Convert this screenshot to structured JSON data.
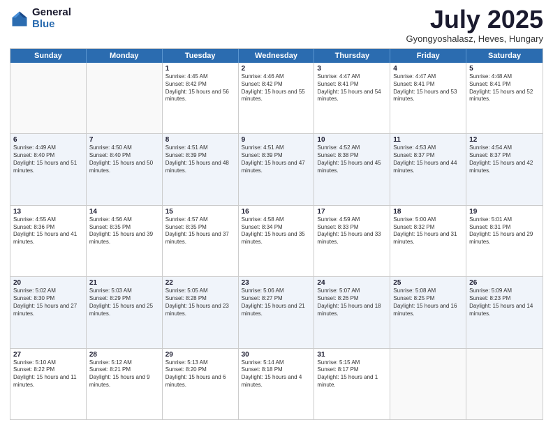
{
  "header": {
    "logo_general": "General",
    "logo_blue": "Blue",
    "title": "July 2025",
    "location": "Gyongyoshalasz, Heves, Hungary"
  },
  "days_of_week": [
    "Sunday",
    "Monday",
    "Tuesday",
    "Wednesday",
    "Thursday",
    "Friday",
    "Saturday"
  ],
  "weeks": [
    {
      "alt": false,
      "cells": [
        {
          "day": "",
          "empty": true
        },
        {
          "day": "",
          "empty": true
        },
        {
          "day": "1",
          "sunrise": "Sunrise: 4:45 AM",
          "sunset": "Sunset: 8:42 PM",
          "daylight": "Daylight: 15 hours and 56 minutes."
        },
        {
          "day": "2",
          "sunrise": "Sunrise: 4:46 AM",
          "sunset": "Sunset: 8:42 PM",
          "daylight": "Daylight: 15 hours and 55 minutes."
        },
        {
          "day": "3",
          "sunrise": "Sunrise: 4:47 AM",
          "sunset": "Sunset: 8:41 PM",
          "daylight": "Daylight: 15 hours and 54 minutes."
        },
        {
          "day": "4",
          "sunrise": "Sunrise: 4:47 AM",
          "sunset": "Sunset: 8:41 PM",
          "daylight": "Daylight: 15 hours and 53 minutes."
        },
        {
          "day": "5",
          "sunrise": "Sunrise: 4:48 AM",
          "sunset": "Sunset: 8:41 PM",
          "daylight": "Daylight: 15 hours and 52 minutes."
        }
      ]
    },
    {
      "alt": true,
      "cells": [
        {
          "day": "6",
          "sunrise": "Sunrise: 4:49 AM",
          "sunset": "Sunset: 8:40 PM",
          "daylight": "Daylight: 15 hours and 51 minutes."
        },
        {
          "day": "7",
          "sunrise": "Sunrise: 4:50 AM",
          "sunset": "Sunset: 8:40 PM",
          "daylight": "Daylight: 15 hours and 50 minutes."
        },
        {
          "day": "8",
          "sunrise": "Sunrise: 4:51 AM",
          "sunset": "Sunset: 8:39 PM",
          "daylight": "Daylight: 15 hours and 48 minutes."
        },
        {
          "day": "9",
          "sunrise": "Sunrise: 4:51 AM",
          "sunset": "Sunset: 8:39 PM",
          "daylight": "Daylight: 15 hours and 47 minutes."
        },
        {
          "day": "10",
          "sunrise": "Sunrise: 4:52 AM",
          "sunset": "Sunset: 8:38 PM",
          "daylight": "Daylight: 15 hours and 45 minutes."
        },
        {
          "day": "11",
          "sunrise": "Sunrise: 4:53 AM",
          "sunset": "Sunset: 8:37 PM",
          "daylight": "Daylight: 15 hours and 44 minutes."
        },
        {
          "day": "12",
          "sunrise": "Sunrise: 4:54 AM",
          "sunset": "Sunset: 8:37 PM",
          "daylight": "Daylight: 15 hours and 42 minutes."
        }
      ]
    },
    {
      "alt": false,
      "cells": [
        {
          "day": "13",
          "sunrise": "Sunrise: 4:55 AM",
          "sunset": "Sunset: 8:36 PM",
          "daylight": "Daylight: 15 hours and 41 minutes."
        },
        {
          "day": "14",
          "sunrise": "Sunrise: 4:56 AM",
          "sunset": "Sunset: 8:35 PM",
          "daylight": "Daylight: 15 hours and 39 minutes."
        },
        {
          "day": "15",
          "sunrise": "Sunrise: 4:57 AM",
          "sunset": "Sunset: 8:35 PM",
          "daylight": "Daylight: 15 hours and 37 minutes."
        },
        {
          "day": "16",
          "sunrise": "Sunrise: 4:58 AM",
          "sunset": "Sunset: 8:34 PM",
          "daylight": "Daylight: 15 hours and 35 minutes."
        },
        {
          "day": "17",
          "sunrise": "Sunrise: 4:59 AM",
          "sunset": "Sunset: 8:33 PM",
          "daylight": "Daylight: 15 hours and 33 minutes."
        },
        {
          "day": "18",
          "sunrise": "Sunrise: 5:00 AM",
          "sunset": "Sunset: 8:32 PM",
          "daylight": "Daylight: 15 hours and 31 minutes."
        },
        {
          "day": "19",
          "sunrise": "Sunrise: 5:01 AM",
          "sunset": "Sunset: 8:31 PM",
          "daylight": "Daylight: 15 hours and 29 minutes."
        }
      ]
    },
    {
      "alt": true,
      "cells": [
        {
          "day": "20",
          "sunrise": "Sunrise: 5:02 AM",
          "sunset": "Sunset: 8:30 PM",
          "daylight": "Daylight: 15 hours and 27 minutes."
        },
        {
          "day": "21",
          "sunrise": "Sunrise: 5:03 AM",
          "sunset": "Sunset: 8:29 PM",
          "daylight": "Daylight: 15 hours and 25 minutes."
        },
        {
          "day": "22",
          "sunrise": "Sunrise: 5:05 AM",
          "sunset": "Sunset: 8:28 PM",
          "daylight": "Daylight: 15 hours and 23 minutes."
        },
        {
          "day": "23",
          "sunrise": "Sunrise: 5:06 AM",
          "sunset": "Sunset: 8:27 PM",
          "daylight": "Daylight: 15 hours and 21 minutes."
        },
        {
          "day": "24",
          "sunrise": "Sunrise: 5:07 AM",
          "sunset": "Sunset: 8:26 PM",
          "daylight": "Daylight: 15 hours and 18 minutes."
        },
        {
          "day": "25",
          "sunrise": "Sunrise: 5:08 AM",
          "sunset": "Sunset: 8:25 PM",
          "daylight": "Daylight: 15 hours and 16 minutes."
        },
        {
          "day": "26",
          "sunrise": "Sunrise: 5:09 AM",
          "sunset": "Sunset: 8:23 PM",
          "daylight": "Daylight: 15 hours and 14 minutes."
        }
      ]
    },
    {
      "alt": false,
      "cells": [
        {
          "day": "27",
          "sunrise": "Sunrise: 5:10 AM",
          "sunset": "Sunset: 8:22 PM",
          "daylight": "Daylight: 15 hours and 11 minutes."
        },
        {
          "day": "28",
          "sunrise": "Sunrise: 5:12 AM",
          "sunset": "Sunset: 8:21 PM",
          "daylight": "Daylight: 15 hours and 9 minutes."
        },
        {
          "day": "29",
          "sunrise": "Sunrise: 5:13 AM",
          "sunset": "Sunset: 8:20 PM",
          "daylight": "Daylight: 15 hours and 6 minutes."
        },
        {
          "day": "30",
          "sunrise": "Sunrise: 5:14 AM",
          "sunset": "Sunset: 8:18 PM",
          "daylight": "Daylight: 15 hours and 4 minutes."
        },
        {
          "day": "31",
          "sunrise": "Sunrise: 5:15 AM",
          "sunset": "Sunset: 8:17 PM",
          "daylight": "Daylight: 15 hours and 1 minute."
        },
        {
          "day": "",
          "empty": true
        },
        {
          "day": "",
          "empty": true
        }
      ]
    }
  ]
}
